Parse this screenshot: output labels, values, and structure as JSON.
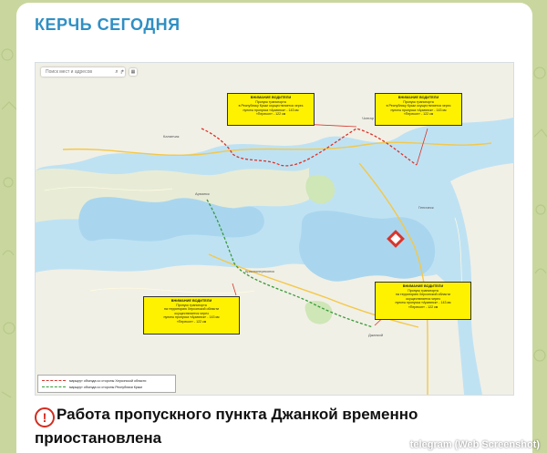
{
  "channel": {
    "name": "КЕРЧЬ СЕГОДНЯ"
  },
  "map": {
    "search_placeholder": "Поиск мест и адресов",
    "callouts": [
      {
        "head": "ВНИМАНИЕ ВОДИТЕЛИ",
        "lines": [
          "Пропуск транспорта",
          "в Республику Крым осуществляется через",
          "пункты пропуска «Армянск» - 143 км",
          "«Перекоп» - 122 км"
        ]
      },
      {
        "head": "ВНИМАНИЕ ВОДИТЕЛИ",
        "lines": [
          "Пропуск транспорта",
          "в Республику Крым осуществляется через",
          "пункты пропуска «Армянск» - 143 км",
          "«Перекоп» - 122 км"
        ]
      },
      {
        "head": "ВНИМАНИЕ ВОДИТЕЛИ",
        "lines": [
          "Пропуск транспорта",
          "на территорию Херсонской области",
          "осуществляется через",
          "пункты пропуска «Армянск» - 143 км",
          "«Перекоп» - 122 км"
        ]
      },
      {
        "head": "ВНИМАНИЕ ВОДИТЕЛИ",
        "lines": [
          "Пропуск транспорта",
          "на территорию Херсонской области",
          "осуществляется через",
          "пункты пропуска «Армянск» - 143 км",
          "«Перекоп» - 122 км"
        ]
      }
    ],
    "legend": [
      {
        "label": "маршрут объезда со стороны Херсонской области",
        "color": "#d9342b"
      },
      {
        "label": "маршрут объезда со стороны Республики Крым",
        "color": "#3a9a3a"
      }
    ]
  },
  "post": {
    "title": "Работа пропускного пункта Джанкой временно приостановлена"
  },
  "watermark": "telegram (Web Screenshot)"
}
